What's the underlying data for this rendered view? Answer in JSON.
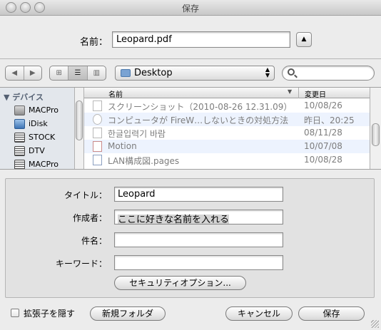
{
  "window": {
    "title": "保存"
  },
  "name_row": {
    "label": "名前：",
    "value": "Leopard.pdf",
    "disclose_glyph": "▲"
  },
  "toolbar": {
    "nav": [
      "◀",
      "▶"
    ],
    "view_modes": [
      "⊞",
      "☰",
      "▥"
    ],
    "location": "Desktop",
    "search_placeholder": ""
  },
  "sidebar": {
    "header": "▼ デバイス",
    "items": [
      {
        "label": "MACPro",
        "icon": "hard-drive-icon"
      },
      {
        "label": "iDisk",
        "icon": "idisk-icon"
      },
      {
        "label": "STOCK",
        "icon": "server-icon"
      },
      {
        "label": "DTV",
        "icon": "server-icon"
      },
      {
        "label": "MACPro",
        "icon": "server-icon"
      }
    ]
  },
  "file_list": {
    "columns": {
      "name": "名前",
      "date": "変更日"
    },
    "rows": [
      {
        "name": "スクリーンショット（2010-08-26 12.31.09）",
        "date": "10/08/26",
        "icon": "image-file-icon"
      },
      {
        "name": "コンピュータが FireW…しないときの対処方法",
        "date": "昨日、20:25",
        "icon": "web-document-icon"
      },
      {
        "name": "한글입력기 바람",
        "date": "08/11/28",
        "icon": "document-icon"
      },
      {
        "name": "Motion",
        "date": "10/07/08",
        "icon": "motion-file-icon"
      },
      {
        "name": "LAN構成図.pages",
        "date": "10/08/28",
        "icon": "pages-document-icon"
      }
    ]
  },
  "metadata": {
    "title_label": "タイトル：",
    "title_value": "Leopard",
    "author_label": "作成者：",
    "author_value": "ここに好きな名前を入れる",
    "subject_label": "件名：",
    "subject_value": "",
    "keywords_label": "キーワード：",
    "keywords_value": "",
    "security_button": "セキュリティオプション..."
  },
  "footer": {
    "hide_extension_label": "拡張子を隠す",
    "hide_extension_checked": false,
    "new_folder": "新規フォルダ",
    "cancel": "キャンセル",
    "save": "保存"
  }
}
